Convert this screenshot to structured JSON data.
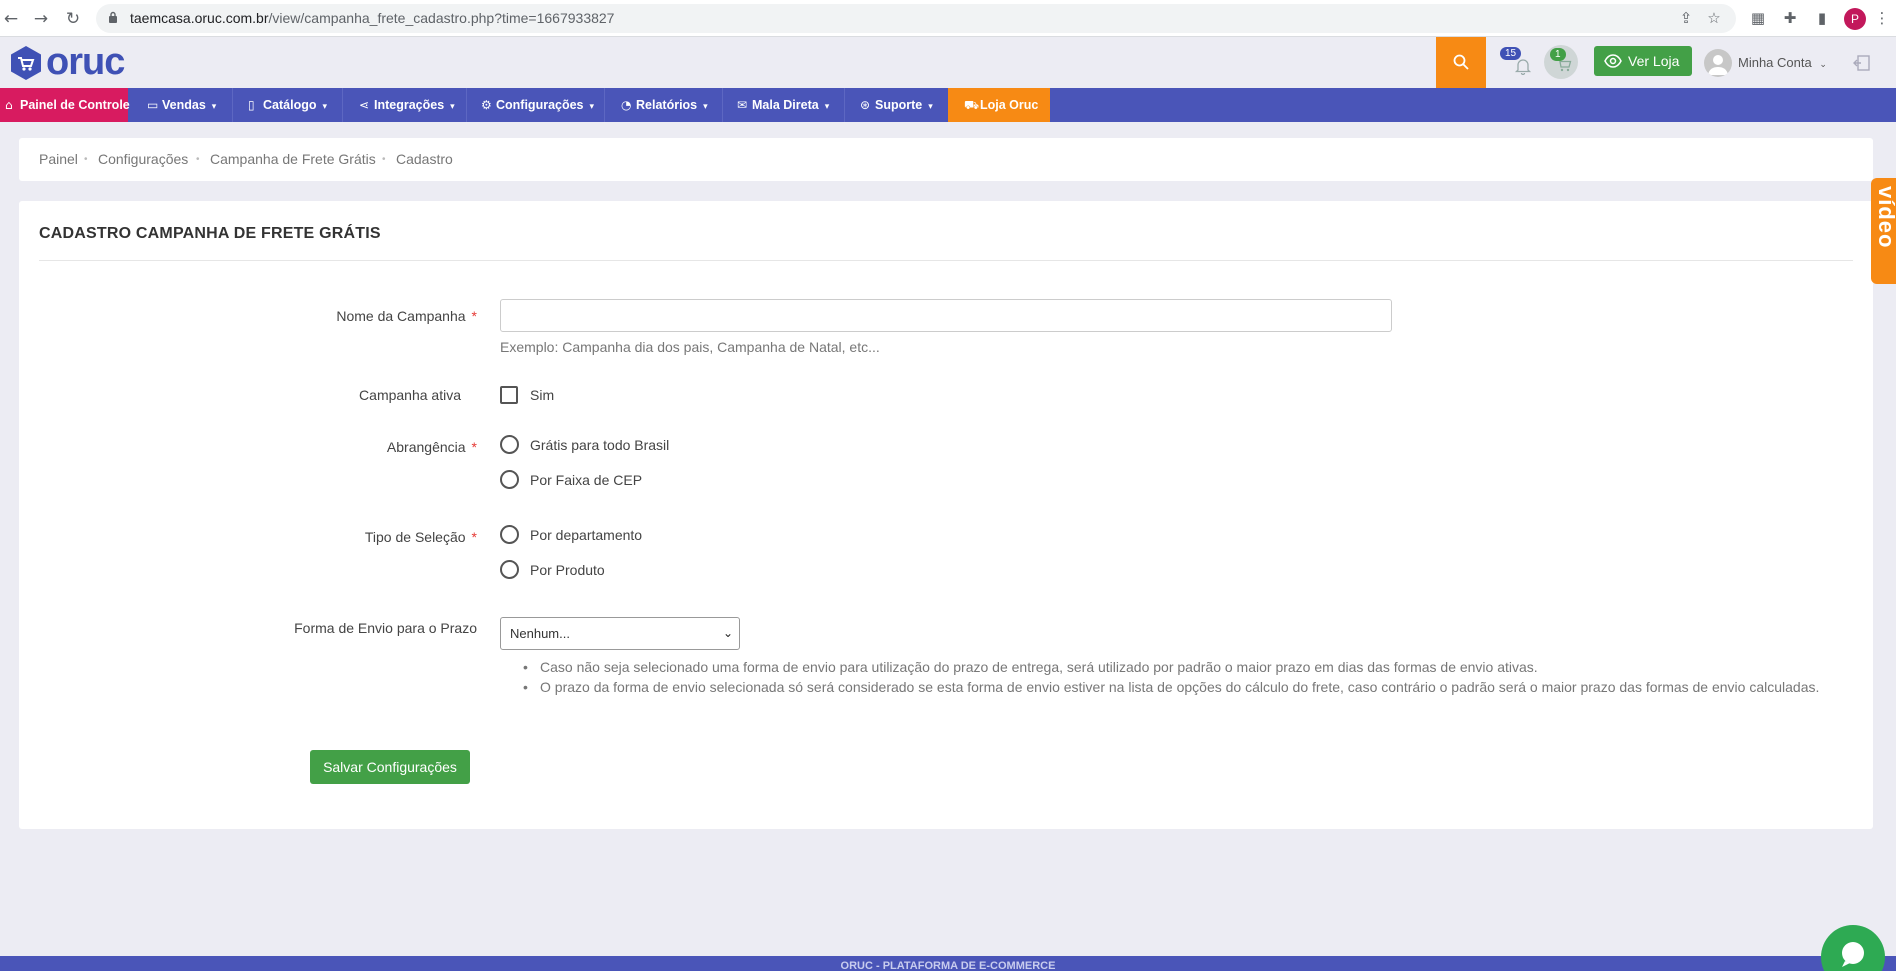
{
  "browser": {
    "url_domain": "taemcasa.oruc.com.br",
    "url_path": "/view/campanha_frete_cadastro.php?time=1667933827",
    "profile_initial": "P"
  },
  "header": {
    "logo_text": "oruc",
    "notifications_count": "15",
    "cart_count": "1",
    "ver_loja_label": "Ver Loja",
    "account_label": "Minha Conta"
  },
  "nav": {
    "items": [
      {
        "label": "Painel de Controle",
        "icon": "home-icon"
      },
      {
        "label": "Vendas",
        "icon": "folder-icon"
      },
      {
        "label": "Catálogo",
        "icon": "book-icon"
      },
      {
        "label": "Integrações",
        "icon": "share-icon"
      },
      {
        "label": "Configurações",
        "icon": "gear-icon"
      },
      {
        "label": "Relatórios",
        "icon": "chart-icon"
      },
      {
        "label": "Mala Direta",
        "icon": "mail-icon"
      },
      {
        "label": "Suporte",
        "icon": "support-icon"
      },
      {
        "label": "Loja Oruc",
        "icon": "cart-icon"
      }
    ]
  },
  "breadcrumb": [
    "Painel",
    "Configurações",
    "Campanha de Frete Grátis",
    "Cadastro"
  ],
  "form": {
    "title": "CADASTRO CAMPANHA DE FRETE GRÁTIS",
    "nome_label": "Nome da Campanha",
    "nome_value": "",
    "nome_help": "Exemplo: Campanha dia dos pais, Campanha de Natal, etc...",
    "ativa_label": "Campanha ativa",
    "ativa_option": "Sim",
    "ativa_checked": false,
    "abrangencia_label": "Abrangência",
    "abrangencia_options": [
      "Grátis para todo Brasil",
      "Por Faixa de CEP"
    ],
    "tipo_label": "Tipo de Seleção",
    "tipo_options": [
      "Por departamento",
      "Por Produto"
    ],
    "envio_label": "Forma de Envio para o Prazo",
    "envio_selected": "Nenhum...",
    "notes": [
      "Caso não seja selecionado uma forma de envio para utilização do prazo de entrega, será utilizado por padrão o maior prazo em dias das formas de envio ativas.",
      "O prazo da forma de envio selecionada só será considerado se esta forma de envio estiver na lista de opções do cálculo do frete, caso contrário o padrão será o maior prazo das formas de envio calculadas."
    ],
    "required_marker": "*",
    "save_label": "Salvar Configurações"
  },
  "side_tab": {
    "label": "vídeo"
  },
  "footer": {
    "text": "ORUC - PLATAFORMA DE E-COMMERCE"
  },
  "colors": {
    "nav_bg": "#4a55b8",
    "painel_bg": "#d81b60",
    "accent_orange": "#f78a14",
    "success_green": "#43a047"
  }
}
